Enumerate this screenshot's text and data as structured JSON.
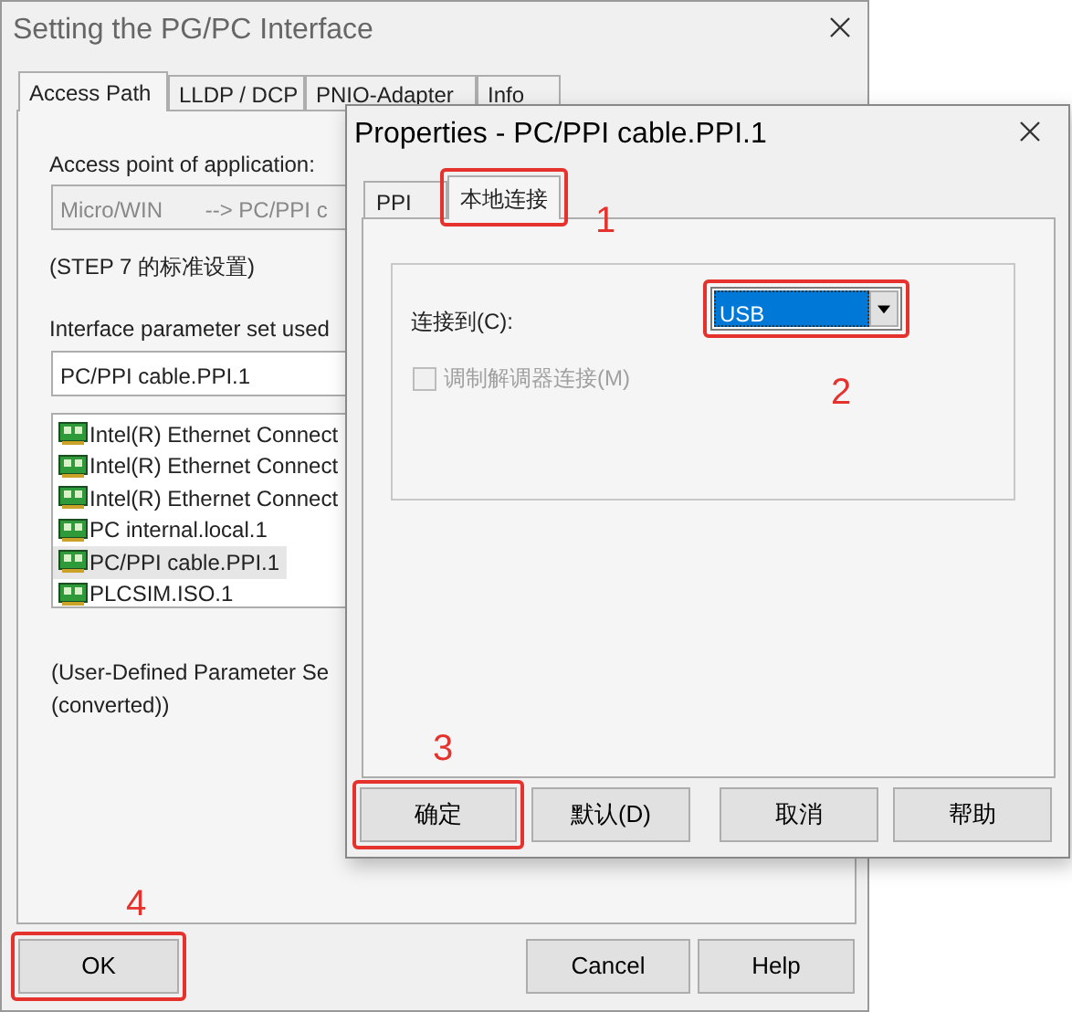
{
  "main_window": {
    "title": "Setting the PG/PC Interface",
    "tabs": [
      {
        "label": "Access Path",
        "selected": true
      },
      {
        "label": "LLDP / DCP",
        "selected": false
      },
      {
        "label": "PNIO-Adapter",
        "selected": false
      },
      {
        "label": "Info",
        "selected": false
      }
    ],
    "access_point_label": "Access point of application:",
    "access_point_value": "Micro/WIN       --> PC/PPI c",
    "standard_note": "(STEP 7 的标准设置)",
    "parameter_set_label": "Interface parameter set used",
    "parameter_set_value": "PC/PPI cable.PPI.1",
    "interfaces": [
      {
        "label": "Intel(R) Ethernet Connect",
        "selected": false
      },
      {
        "label": "Intel(R) Ethernet Connect",
        "selected": false
      },
      {
        "label": "Intel(R) Ethernet Connect",
        "selected": false
      },
      {
        "label": "PC internal.local.1",
        "selected": false
      },
      {
        "label": "PC/PPI cable.PPI.1",
        "selected": true
      },
      {
        "label": "PLCSIM.ISO.1",
        "selected": false
      }
    ],
    "description": [
      "(User-Defined Parameter Se",
      "(converted))"
    ],
    "buttons": [
      {
        "label": "OK",
        "highlighted": true
      },
      {
        "label": "Cancel",
        "highlighted": false
      },
      {
        "label": "Help",
        "highlighted": false
      }
    ]
  },
  "properties_dialog": {
    "title": "Properties - PC/PPI cable.PPI.1",
    "tabs": [
      {
        "label": "PPI",
        "selected": false,
        "highlighted": false
      },
      {
        "label": "本地连接",
        "selected": true,
        "highlighted": true
      }
    ],
    "connect_to_label": "连接到(C):",
    "connect_to_value": "USB",
    "connect_to_highlighted": true,
    "modem_checkbox": {
      "label": "调制解调器连接(M)",
      "checked": false,
      "disabled": true
    },
    "buttons": [
      {
        "label": "确定",
        "highlighted": true
      },
      {
        "label": "默认(D)",
        "highlighted": false
      },
      {
        "label": "取消",
        "highlighted": false
      },
      {
        "label": "帮助",
        "highlighted": false
      }
    ]
  },
  "annotations": [
    "1",
    "2",
    "3",
    "4"
  ]
}
